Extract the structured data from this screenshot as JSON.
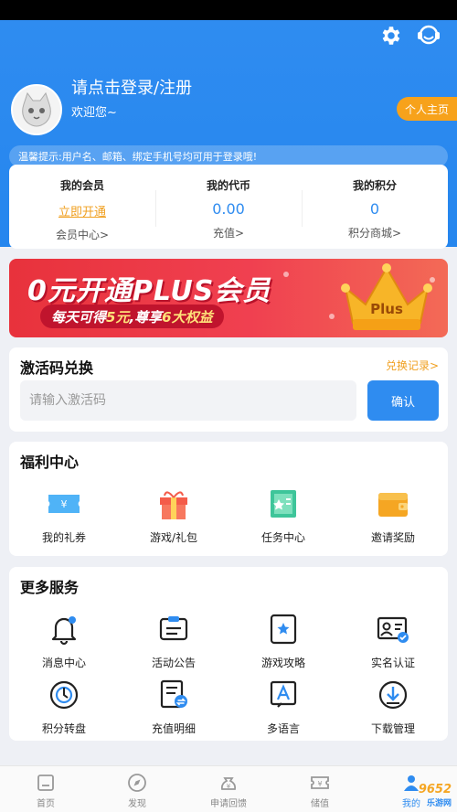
{
  "header": {
    "login_text": "请点击登录/注册",
    "welcome_text": "欢迎您~",
    "profile_button": "个人主页",
    "tip": "温馨提示:用户名、邮箱、绑定手机号均可用于登录哦!",
    "settings_icon": "gear-icon",
    "service_icon": "headset-icon"
  },
  "stats": [
    {
      "title": "我的会员",
      "value": "立即开通",
      "link": "会员中心>"
    },
    {
      "title": "我的代币",
      "value": "0.00",
      "link": "充值>"
    },
    {
      "title": "我的积分",
      "value": "0",
      "link": "积分商城>"
    }
  ],
  "banner": {
    "title": "0元开通PLUS会员",
    "subtitle_prefix": "每天可得",
    "subtitle_highlight1": "5元",
    "subtitle_mid": ",尊享",
    "subtitle_highlight2": "6大权益",
    "crown_text": "Plus"
  },
  "redeem": {
    "title": "激活码兑换",
    "record_link": "兑换记录>",
    "placeholder": "请输入激活码",
    "confirm": "确认"
  },
  "welfare": {
    "title": "福利中心",
    "items": [
      {
        "label": "我的礼券",
        "icon": "coupon-icon"
      },
      {
        "label": "游戏/礼包",
        "icon": "gift-icon"
      },
      {
        "label": "任务中心",
        "icon": "task-book-icon"
      },
      {
        "label": "邀请奖励",
        "icon": "wallet-icon"
      }
    ]
  },
  "services": {
    "title": "更多服务",
    "items": [
      {
        "label": "消息中心",
        "icon": "bell-icon"
      },
      {
        "label": "活动公告",
        "icon": "announcement-icon"
      },
      {
        "label": "游戏攻略",
        "icon": "guide-book-icon"
      },
      {
        "label": "实名认证",
        "icon": "id-card-icon"
      },
      {
        "label": "积分转盘",
        "icon": "wheel-icon"
      },
      {
        "label": "充值明细",
        "icon": "recharge-detail-icon"
      },
      {
        "label": "多语言",
        "icon": "language-icon"
      },
      {
        "label": "下载管理",
        "icon": "download-icon"
      }
    ]
  },
  "nav": [
    {
      "label": "首页",
      "icon": "home-icon"
    },
    {
      "label": "发现",
      "icon": "compass-icon"
    },
    {
      "label": "申请回馈",
      "icon": "money-bag-icon"
    },
    {
      "label": "储值",
      "icon": "ticket-icon"
    },
    {
      "label": "我的",
      "icon": "user-icon"
    }
  ],
  "watermark": {
    "brand": "9652",
    "sub": "乐游网"
  },
  "colors": {
    "primary": "#2f8cf0",
    "accent": "#f7a21b",
    "banner": "#e8323c"
  }
}
